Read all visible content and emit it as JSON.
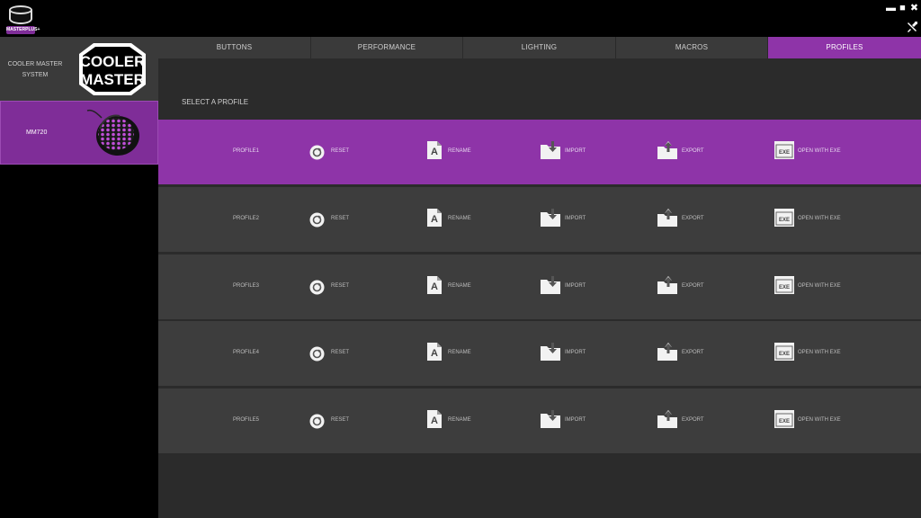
{
  "app": {
    "logo_text": "MASTERPLUS+",
    "window_controls": {
      "minimize": "▬",
      "maximize": "■",
      "close": "✖"
    }
  },
  "sidebar": {
    "system_label": "COOLER MASTER\nSYSTEM",
    "brand_logo_text": [
      "COOLER",
      "MASTER"
    ],
    "device_label": "MM720"
  },
  "tabs": [
    {
      "label": "BUTTONS",
      "active": false
    },
    {
      "label": "PERFORMANCE",
      "active": false
    },
    {
      "label": "LIGHTING",
      "active": false
    },
    {
      "label": "MACROS",
      "active": false
    },
    {
      "label": "PROFILES",
      "active": true
    }
  ],
  "main": {
    "section_title": "SELECT A PROFILE",
    "actions": [
      {
        "label": "RESET",
        "icon": "reset-icon"
      },
      {
        "label": "RENAME",
        "icon": "rename-icon"
      },
      {
        "label": "IMPORT",
        "icon": "import-icon"
      },
      {
        "label": "EXPORT",
        "icon": "export-icon"
      },
      {
        "label": "OPEN WITH EXE",
        "icon": "exe-icon"
      }
    ],
    "exe_icon_text": "EXE",
    "profiles": [
      {
        "name": "PROFILE1",
        "active": true
      },
      {
        "name": "PROFILE2",
        "active": false
      },
      {
        "name": "PROFILE3",
        "active": false
      },
      {
        "name": "PROFILE4",
        "active": false
      },
      {
        "name": "PROFILE5",
        "active": false
      }
    ]
  },
  "colors": {
    "accent": "#8e34a8",
    "row_bg": "#3d3d3d",
    "panel_bg": "#2b2b2b",
    "tab_bg": "#3a3a3a"
  }
}
